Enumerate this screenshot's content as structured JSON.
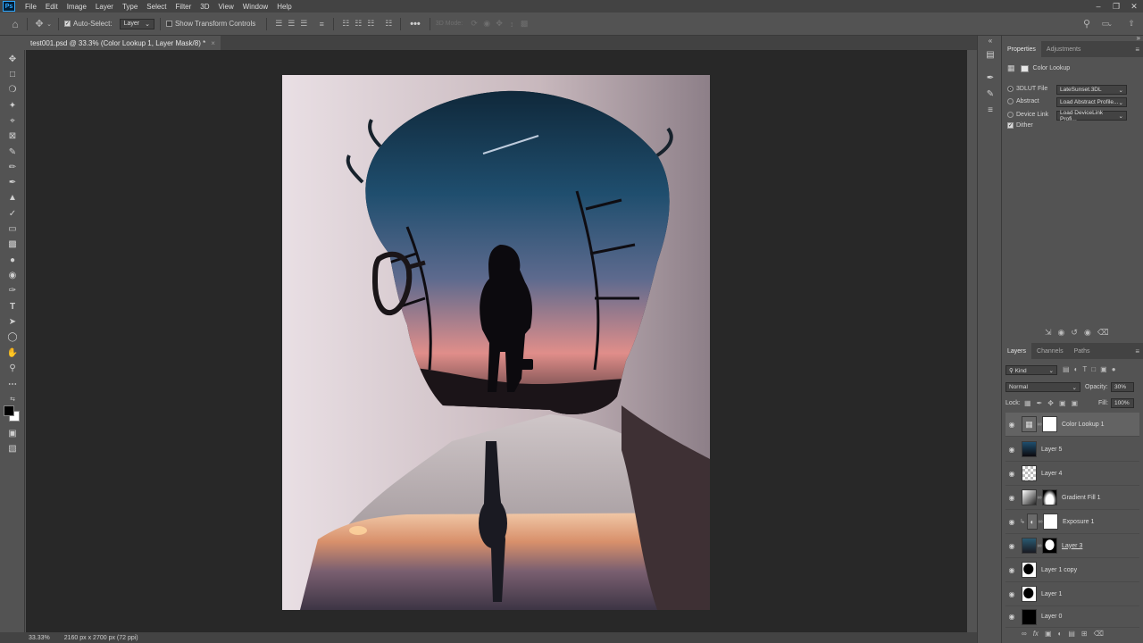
{
  "app": {
    "logo": "Ps"
  },
  "menu": [
    "File",
    "Edit",
    "Image",
    "Layer",
    "Type",
    "Select",
    "Filter",
    "3D",
    "View",
    "Window",
    "Help"
  ],
  "options": {
    "auto_select_label": "Auto-Select:",
    "auto_select_value": "Layer",
    "show_transform_label": "Show Transform Controls",
    "mode_3d_label": "3D Mode:",
    "more": "•••"
  },
  "document": {
    "tab_title": "test001.psd @ 33.3% (Color Lookup 1, Layer Mask/8) *",
    "close": "×"
  },
  "status": {
    "zoom": "33.33%",
    "dimensions": "2160 px x 2700 px (72 ppi)"
  },
  "properties": {
    "tabs": [
      "Properties",
      "Adjustments"
    ],
    "header": "Color Lookup",
    "rows": [
      {
        "label": "3DLUT File",
        "value": "LateSunset.3DL",
        "selected": true
      },
      {
        "label": "Abstract",
        "value": "Load Abstract Profile...",
        "selected": false
      },
      {
        "label": "Device Link",
        "value": "Load DeviceLink Profi...",
        "selected": false
      }
    ],
    "dither_label": "Dither"
  },
  "layers_panel": {
    "tabs": [
      "Layers",
      "Channels",
      "Paths"
    ],
    "filter": "Kind",
    "blend_mode": "Normal",
    "opacity_label": "Opacity:",
    "opacity_value": "30%",
    "lock_label": "Lock:",
    "fill_label": "Fill:",
    "fill_value": "100%",
    "layers": [
      {
        "name": "Color Lookup 1",
        "selected": true
      },
      {
        "name": "Layer 5",
        "selected": false
      },
      {
        "name": "Layer 4",
        "selected": false
      },
      {
        "name": "Gradient Fill 1",
        "selected": false
      },
      {
        "name": "Exposure 1",
        "selected": false
      },
      {
        "name": "Layer 3",
        "selected": false
      },
      {
        "name": "Layer 1 copy",
        "selected": false
      },
      {
        "name": "Layer 1",
        "selected": false
      },
      {
        "name": "Layer 0",
        "selected": false
      }
    ]
  },
  "colors": {
    "accent": "#31a8ff",
    "panel": "#535353",
    "canvas": "#282828"
  }
}
